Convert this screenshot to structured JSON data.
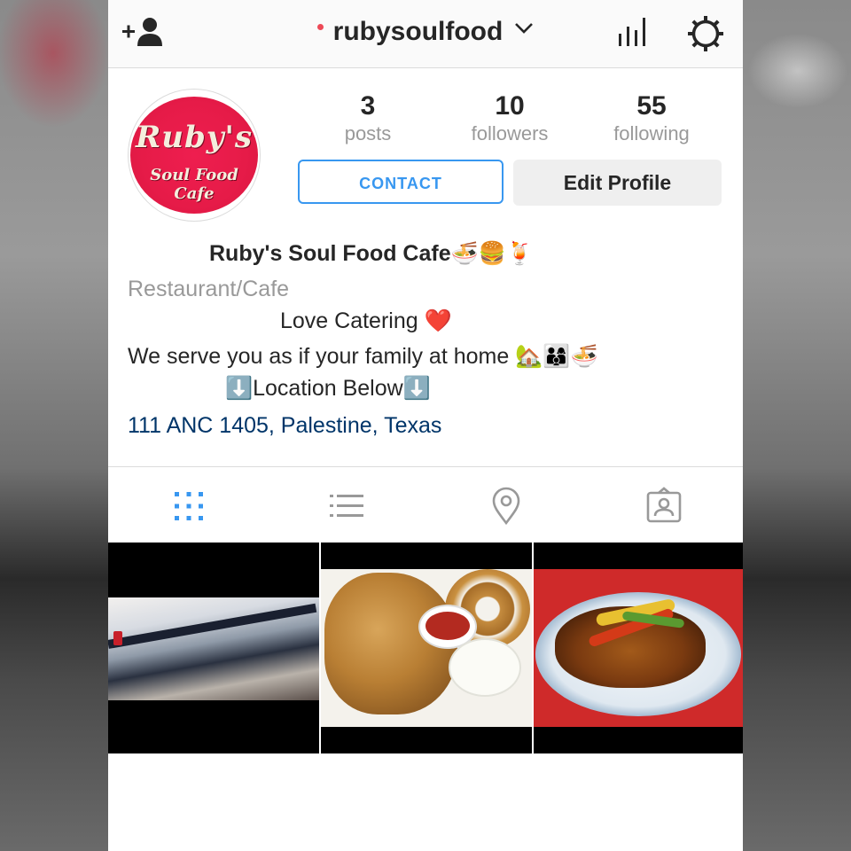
{
  "header": {
    "username": "rubysoulfood"
  },
  "profile": {
    "avatar_text_line1": "Ruby's",
    "avatar_text_line2": "Soul Food Cafe",
    "stats": [
      {
        "value": "3",
        "label": "posts"
      },
      {
        "value": "10",
        "label": "followers"
      },
      {
        "value": "55",
        "label": "following"
      }
    ],
    "contact_label": "CONTACT",
    "edit_label": "Edit Profile"
  },
  "bio": {
    "name": "Ruby's Soul Food Cafe🍜🍔🍹",
    "category": "Restaurant/Cafe",
    "lines": [
      "Love Catering ❤️",
      "We serve you as if your family at home 🏡👨‍👩‍👦🍜",
      "⬇️Location Below⬇️"
    ],
    "address": "111 ANC 1405, Palestine, Texas"
  },
  "tabs": [
    "grid",
    "list",
    "place",
    "tagged"
  ],
  "colors": {
    "accent": "#3897f0",
    "link": "#003569",
    "muted": "#999999",
    "live_dot": "#ed4956"
  }
}
